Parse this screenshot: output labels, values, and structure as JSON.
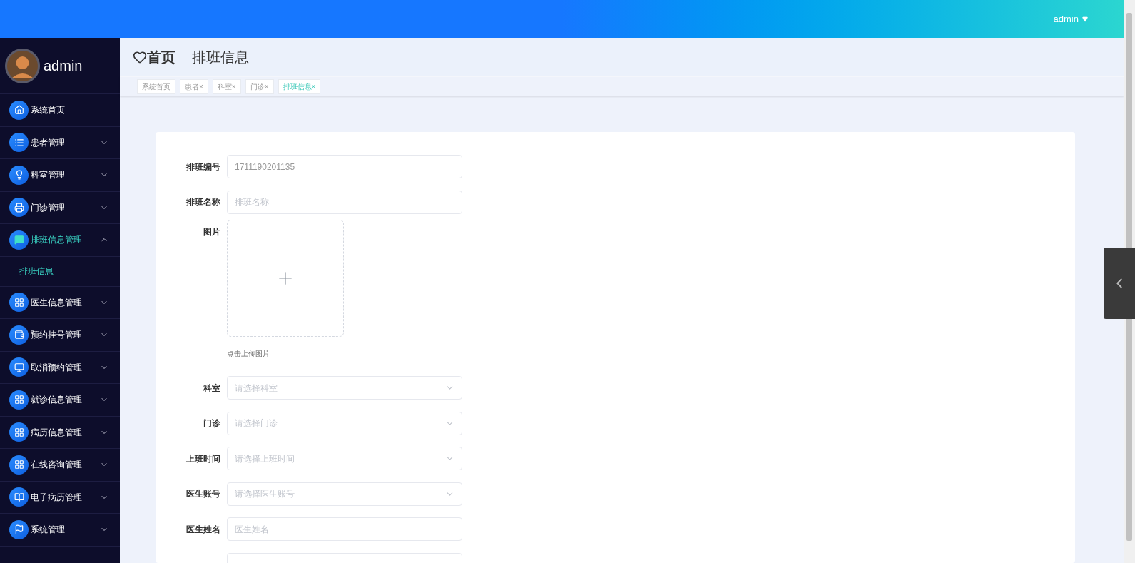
{
  "top_bar": {
    "user": "admin"
  },
  "sidebar": {
    "user": "admin",
    "items": [
      {
        "label": "系统首页",
        "expandable": false,
        "expanded": false
      },
      {
        "label": "患者管理",
        "expandable": true,
        "expanded": false
      },
      {
        "label": "科室管理",
        "expandable": true,
        "expanded": false
      },
      {
        "label": "门诊管理",
        "expandable": true,
        "expanded": false
      },
      {
        "label": "排班信息管理",
        "expandable": true,
        "expanded": true,
        "children": [
          {
            "label": "排班信息",
            "selected": true
          }
        ]
      },
      {
        "label": "医生信息管理",
        "expandable": true,
        "expanded": false
      },
      {
        "label": "预约挂号管理",
        "expandable": true,
        "expanded": false
      },
      {
        "label": "取消预约管理",
        "expandable": true,
        "expanded": false
      },
      {
        "label": "就诊信息管理",
        "expandable": true,
        "expanded": false
      },
      {
        "label": "病历信息管理",
        "expandable": true,
        "expanded": false
      },
      {
        "label": "在线咨询管理",
        "expandable": true,
        "expanded": false
      },
      {
        "label": "电子病历管理",
        "expandable": true,
        "expanded": false
      },
      {
        "label": "系统管理",
        "expandable": true,
        "expanded": false
      }
    ]
  },
  "breadcrumb": [
    "首页",
    "排班信息"
  ],
  "tabs": [
    {
      "label": "系统首页",
      "closable": false,
      "selected": false
    },
    {
      "label": "患者",
      "closable": true,
      "selected": false
    },
    {
      "label": "科室",
      "closable": true,
      "selected": false
    },
    {
      "label": "门诊",
      "closable": true,
      "selected": false
    },
    {
      "label": "排班信息",
      "closable": true,
      "selected": true
    }
  ],
  "tab_close": "×",
  "form": {
    "fields": [
      {
        "kind": "text",
        "label": "排班编号",
        "value": "1711190201135"
      },
      {
        "kind": "text",
        "label": "排班名称",
        "placeholder": "排班名称"
      },
      {
        "kind": "upload",
        "label": "图片",
        "hint": "点击上传图片"
      },
      {
        "kind": "select",
        "label": "科室",
        "placeholder": "请选择科室"
      },
      {
        "kind": "select",
        "label": "门诊",
        "placeholder": "请选择门诊"
      },
      {
        "kind": "select",
        "label": "上班时间",
        "placeholder": "请选择上班时间"
      },
      {
        "kind": "select",
        "label": "医生账号",
        "placeholder": "请选择医生账号"
      },
      {
        "kind": "text",
        "label": "医生姓名",
        "placeholder": "医生姓名"
      },
      {
        "kind": "text"
      }
    ]
  }
}
